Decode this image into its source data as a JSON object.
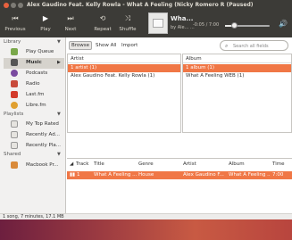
{
  "window": {
    "title": "Alex Gaudino Feat. Kelly Rowla - What A Feeling (Nicky Romero R (Paused)"
  },
  "toolbar": {
    "previous": "Previous",
    "play": "Play",
    "next": "Next",
    "repeat": "Repeat",
    "shuffle": "Shuffle",
    "icons": {
      "previous": "previous-icon",
      "play": "play-icon",
      "next": "next-icon",
      "repeat": "repeat-icon",
      "shuffle": "shuffle-icon"
    }
  },
  "now_playing": {
    "title": "Wha...",
    "subtitle": "by Ale... ...",
    "time": "-0:05 / 7:00",
    "progress": 0.19,
    "volume": 0.55
  },
  "sidebar": {
    "library_label": "Library",
    "playlists_label": "Playlists",
    "shared_label": "Shared",
    "library_items": [
      {
        "label": "Play Queue",
        "icon": "queue-icon",
        "color": "#7aa84a"
      },
      {
        "label": "Music",
        "icon": "music-icon",
        "color": "#555555"
      },
      {
        "label": "Podcasts",
        "icon": "podcast-icon",
        "color": "#7a4ba0"
      },
      {
        "label": "Radio",
        "icon": "radio-icon",
        "color": "#c84a3a"
      },
      {
        "label": "Last.fm",
        "icon": "lastfm-icon",
        "color": "#d33a2a"
      },
      {
        "label": "Libre.fm",
        "icon": "librefm-icon",
        "color": "#e0a030"
      }
    ],
    "playlist_items": [
      {
        "label": "My Top Rated",
        "icon": "playlist-icon"
      },
      {
        "label": "Recently Ad...",
        "icon": "playlist-icon"
      },
      {
        "label": "Recently Pla...",
        "icon": "playlist-icon"
      }
    ],
    "shared_items": [
      {
        "label": "Macbook Pr...",
        "icon": "computer-icon"
      }
    ]
  },
  "browser": {
    "browse_label": "Browse",
    "show_all_label": "Show All",
    "import_label": "Import",
    "search_placeholder": "Search all fields",
    "artist_header": "Artist",
    "album_header": "Album",
    "artist_rows": [
      "1 artist (1)",
      "Alex Gaudino Feat. Kelly Rowla (1)"
    ],
    "album_rows": [
      "1 album (1)",
      "What A Feeling WEB (1)"
    ]
  },
  "tracks": {
    "headers": [
      "Track",
      "Title",
      "Genre",
      "Artist",
      "Album",
      "Time"
    ],
    "rows": [
      {
        "track": "1",
        "title": "What A Feeling ...",
        "genre": "House",
        "artist": "Alex Gaudino F...",
        "album": "What A Feeling ...",
        "time": "7:00"
      }
    ]
  },
  "status": {
    "text": "1 song, 7 minutes, 17.1 MB"
  }
}
